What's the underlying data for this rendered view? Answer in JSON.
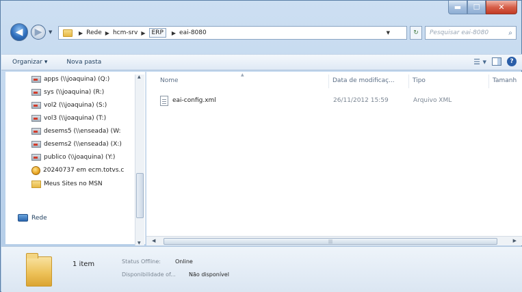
{
  "address": {
    "crumbs": [
      "Rede",
      "hcm-srv",
      "ERP",
      "eai-8080"
    ],
    "search_placeholder": "Pesquisar eai-8080"
  },
  "toolbar": {
    "organize_label": "Organizar ▾",
    "new_folder_label": "Nova pasta"
  },
  "nav_pane": {
    "items": [
      {
        "label": "apps (\\\\joaquina) (Q:)",
        "icon": "network-drive-icon"
      },
      {
        "label": "sys (\\\\joaquina) (R:)",
        "icon": "network-drive-icon"
      },
      {
        "label": "vol2 (\\\\joaquina) (S:)",
        "icon": "network-drive-icon"
      },
      {
        "label": "vol3 (\\\\joaquina) (T:)",
        "icon": "network-drive-icon"
      },
      {
        "label": "desems5 (\\\\enseada) (W:",
        "icon": "network-drive-icon"
      },
      {
        "label": "desems2 (\\\\enseada) (X:)",
        "icon": "network-drive-icon"
      },
      {
        "label": "publico (\\\\joaquina) (Y:)",
        "icon": "network-drive-icon"
      },
      {
        "label": "20240737 em ecm.totvs.c",
        "icon": "globe-icon"
      },
      {
        "label": "Meus Sites no MSN",
        "icon": "folder-icon"
      }
    ],
    "network_label": "Rede"
  },
  "content": {
    "columns": [
      "Nome",
      "Data de modificaç...",
      "Tipo",
      "Tamanh"
    ],
    "files": [
      {
        "name": "eai-config.xml",
        "modified": "26/11/2012 15:59",
        "type": "Arquivo XML"
      }
    ]
  },
  "details": {
    "count": "1 item",
    "status_label": "Status Offline:",
    "status_value": "Online",
    "availability_label": "Disponibilidade of...",
    "availability_value": "Não disponível"
  }
}
